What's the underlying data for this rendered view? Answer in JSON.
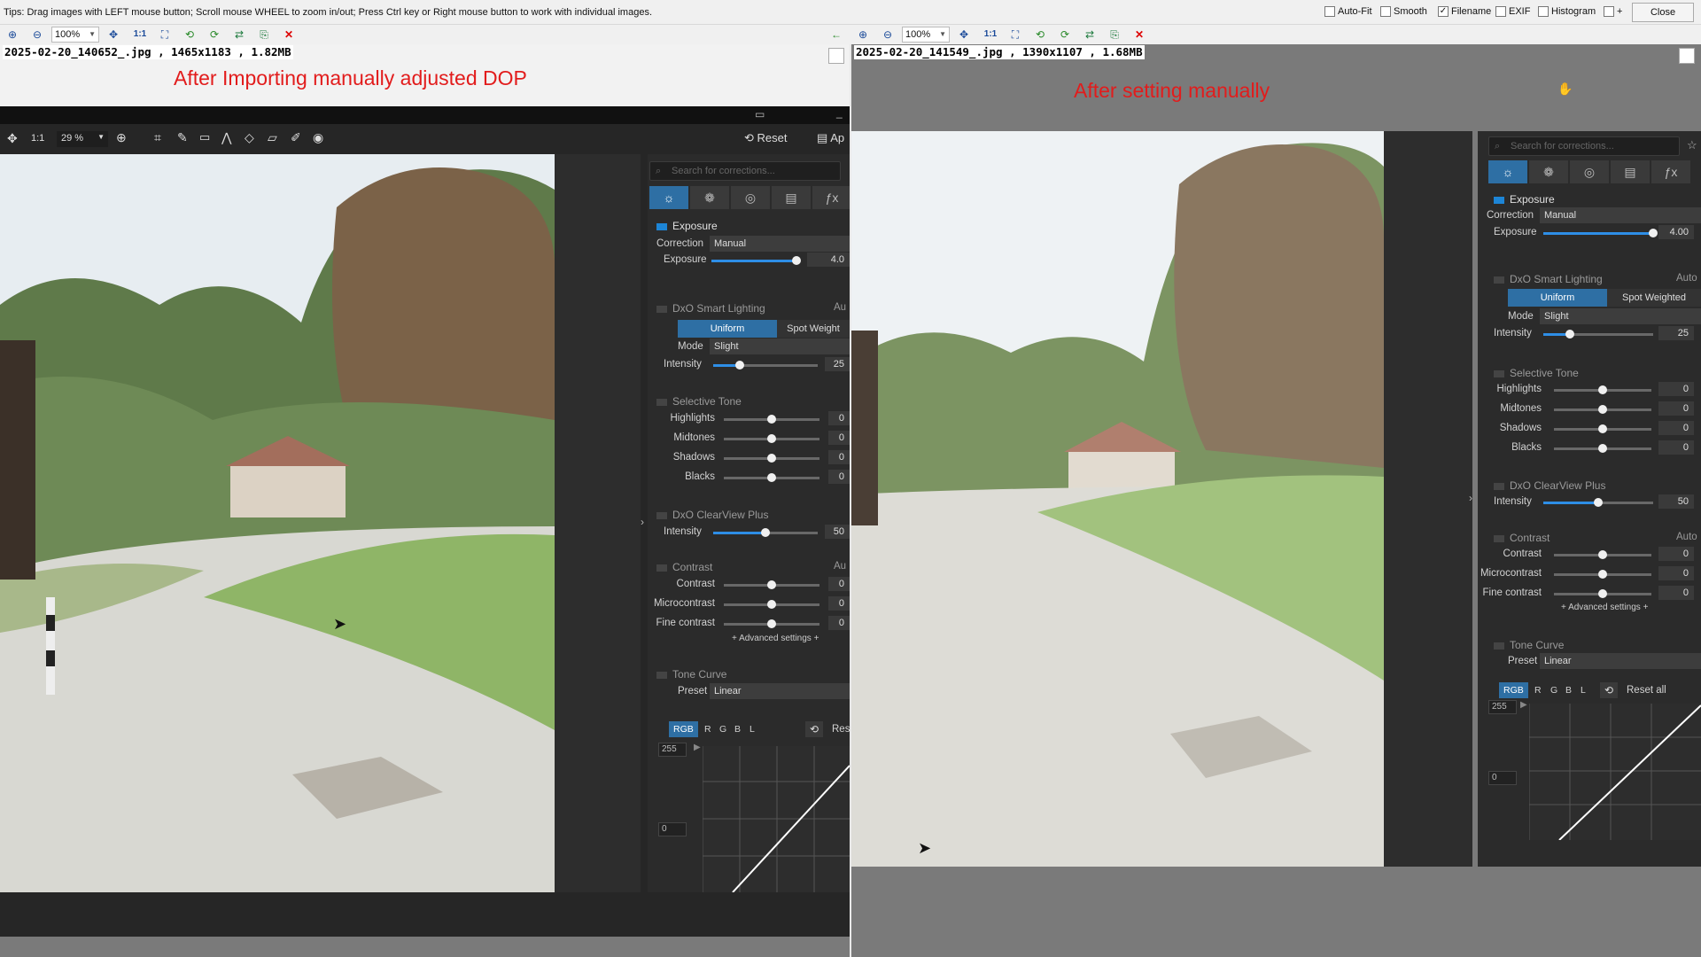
{
  "tipbar": {
    "tip": "Tips: Drag images with LEFT mouse button; Scroll mouse WHEEL to zoom in/out; Press Ctrl key or Right mouse button to work with individual images.",
    "options": [
      {
        "label": "Auto-Fit",
        "checked": false
      },
      {
        "label": "Smooth",
        "checked": false
      },
      {
        "label": "Filename",
        "checked": true
      },
      {
        "label": "EXIF",
        "checked": false
      },
      {
        "label": "Histogram",
        "checked": false
      },
      {
        "label": "+",
        "checked": false
      }
    ],
    "close_label": "Close"
  },
  "left": {
    "zoom": "100%",
    "fit_label": "1:1",
    "fileinfo": "2025-02-20_140652_.jpg , 1465x1183 , 1.82MB",
    "caption": "After Importing manually adjusted DOP",
    "dxo_toolbar": {
      "ratio": "1:1",
      "zoom": "29 %",
      "reset": "Reset",
      "apply": "Ap"
    },
    "panel": {
      "search_placeholder": "Search for corrections...",
      "exposure": {
        "title": "Exposure",
        "correction_label": "Correction",
        "correction_value": "Manual",
        "exposure_label": "Exposure",
        "exposure_value": "4.0"
      },
      "smart_lighting": {
        "title": "DxO Smart Lighting",
        "auto": "Au",
        "uniform": "Uniform",
        "spot": "Spot Weight",
        "mode_label": "Mode",
        "mode_value": "Slight",
        "intensity_label": "Intensity",
        "intensity_value": "25"
      },
      "selective_tone": {
        "title": "Selective Tone",
        "rows": [
          {
            "label": "Highlights",
            "value": "0"
          },
          {
            "label": "Midtones",
            "value": "0"
          },
          {
            "label": "Shadows",
            "value": "0"
          },
          {
            "label": "Blacks",
            "value": "0"
          }
        ]
      },
      "clearview": {
        "title": "DxO ClearView Plus",
        "intensity_label": "Intensity",
        "intensity_value": "50"
      },
      "contrast": {
        "title": "Contrast",
        "auto": "Au",
        "rows": [
          {
            "label": "Contrast",
            "value": "0"
          },
          {
            "label": "Microcontrast",
            "value": "0"
          },
          {
            "label": "Fine contrast",
            "value": "0"
          }
        ],
        "advanced": "+ Advanced settings +"
      },
      "tone_curve": {
        "title": "Tone Curve",
        "preset_label": "Preset",
        "preset_value": "Linear",
        "channels": [
          "RGB",
          "R",
          "G",
          "B",
          "L"
        ],
        "reset": "Res",
        "top": "255",
        "bottom": "0"
      }
    }
  },
  "right": {
    "zoom": "100%",
    "fit_label": "1:1",
    "fileinfo": "2025-02-20_141549_.jpg , 1390x1107 , 1.68MB",
    "caption": "After setting manually",
    "panel": {
      "search_placeholder": "Search for corrections...",
      "exposure": {
        "title": "Exposure",
        "correction_label": "Correction",
        "correction_value": "Manual",
        "exposure_label": "Exposure",
        "exposure_value": "4.00"
      },
      "smart_lighting": {
        "title": "DxO Smart Lighting",
        "auto": "Auto",
        "uniform": "Uniform",
        "spot": "Spot Weighted",
        "mode_label": "Mode",
        "mode_value": "Slight",
        "intensity_label": "Intensity",
        "intensity_value": "25"
      },
      "selective_tone": {
        "title": "Selective Tone",
        "rows": [
          {
            "label": "Highlights",
            "value": "0"
          },
          {
            "label": "Midtones",
            "value": "0"
          },
          {
            "label": "Shadows",
            "value": "0"
          },
          {
            "label": "Blacks",
            "value": "0"
          }
        ]
      },
      "clearview": {
        "title": "DxO ClearView Plus",
        "intensity_label": "Intensity",
        "intensity_value": "50"
      },
      "contrast": {
        "title": "Contrast",
        "auto": "Auto",
        "rows": [
          {
            "label": "Contrast",
            "value": "0"
          },
          {
            "label": "Microcontrast",
            "value": "0"
          },
          {
            "label": "Fine contrast",
            "value": "0"
          }
        ],
        "advanced": "+ Advanced settings +"
      },
      "tone_curve": {
        "title": "Tone Curve",
        "preset_label": "Preset",
        "preset_value": "Linear",
        "channels": [
          "RGB",
          "R",
          "G",
          "B",
          "L"
        ],
        "reset": "Reset all",
        "top": "255",
        "bottom": "0"
      }
    }
  },
  "colors": {
    "accent": "#2e6fa4",
    "caption": "#e21c1c",
    "slider_fill": "#2e8ee6"
  }
}
